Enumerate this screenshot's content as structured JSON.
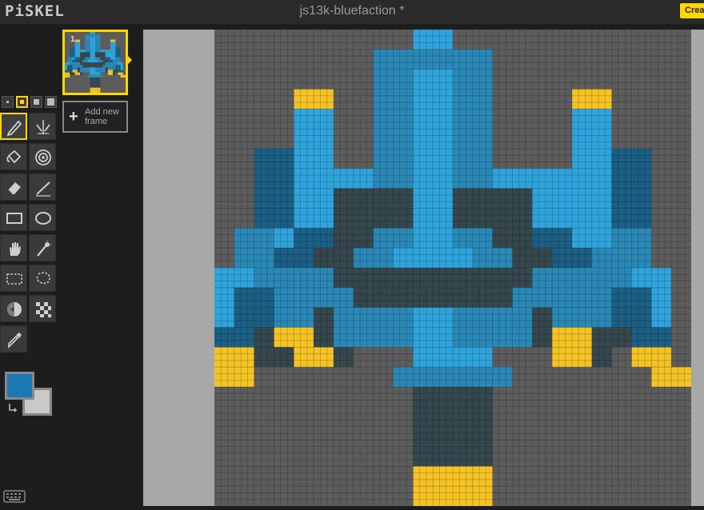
{
  "app": {
    "logo": "PiSKEL",
    "title": "js13k-bluefaction *",
    "create_button": "Create"
  },
  "pen_sizes": [
    {
      "name": "pen-size-1",
      "active": false
    },
    {
      "name": "pen-size-2",
      "active": true
    },
    {
      "name": "pen-size-3",
      "active": false
    },
    {
      "name": "pen-size-4",
      "active": false
    }
  ],
  "tools": [
    {
      "name": "pen-tool",
      "icon": "pencil-icon",
      "active": true
    },
    {
      "name": "vertical-mirror-pen-tool",
      "icon": "mirror-pen-icon",
      "active": false
    },
    {
      "name": "paint-bucket-tool",
      "icon": "paint-bucket-icon",
      "active": false
    },
    {
      "name": "paint-same-color-tool",
      "icon": "target-icon",
      "active": false
    },
    {
      "name": "eraser-tool",
      "icon": "eraser-icon",
      "active": false
    },
    {
      "name": "stroke-tool",
      "icon": "stroke-icon",
      "active": false
    },
    {
      "name": "rectangle-tool",
      "icon": "rectangle-icon",
      "active": false
    },
    {
      "name": "circle-tool",
      "icon": "circle-icon",
      "active": false
    },
    {
      "name": "move-tool",
      "icon": "hand-icon",
      "active": false
    },
    {
      "name": "shape-select-tool",
      "icon": "magic-wand-icon",
      "active": false
    },
    {
      "name": "rectangle-select-tool",
      "icon": "rect-select-icon",
      "active": false
    },
    {
      "name": "lasso-select-tool",
      "icon": "lasso-icon",
      "active": false
    },
    {
      "name": "lighten-tool",
      "icon": "lighten-icon",
      "active": false
    },
    {
      "name": "dithering-tool",
      "icon": "dither-icon",
      "active": false
    },
    {
      "name": "color-picker-tool",
      "icon": "eyedropper-icon",
      "active": false
    }
  ],
  "colors": {
    "primary": "#1b7ab4",
    "secondary": "#c9c9c9"
  },
  "frames": [
    {
      "index": "1"
    }
  ],
  "add_frame_label": "Add new frame",
  "sprite": {
    "grid_size": 24,
    "palette": {
      ".": "#5c5c5c",
      "a": "#2fa4dc",
      "m": "#2a88b6",
      "d": "#1b5f84",
      "g": "#35474d",
      "y": "#f6c325"
    },
    "rows": [
      "..........aa............",
      "........mmmmmm..........",
      "........mmaamm..........",
      "....yy..mmaamm....yy....",
      "....aa..mmaamm....aa....",
      "....aa..mmaamm....aa....",
      "..ddaa..mmaamm....aadd..",
      "..ddaaaammaammaaaaaadd..",
      "..ddaaggggaaggggaaaadd..",
      "..ddaaggggaaggggaaaadd..",
      ".mmaddggmmaammggddaamm..",
      ".mmddggmmaaaammggddmmm..",
      "aammmmggggggggggmmmmmaa.",
      "addmmmmggggggggmmmmmdda.",
      "addmmgmmmmaammmmgmmmdda.",
      "ddgyygmmmmaammmmgyyggdd.",
      "yyggyyg...aaaa...yyg.yy.",
      "yy.......mmmmmm.......yy",
      "..........gggg..........",
      "..........gggg..........",
      "..........gggg..........",
      "..........gggg..........",
      "..........yyyy..........",
      "..........yyyy.........."
    ]
  }
}
